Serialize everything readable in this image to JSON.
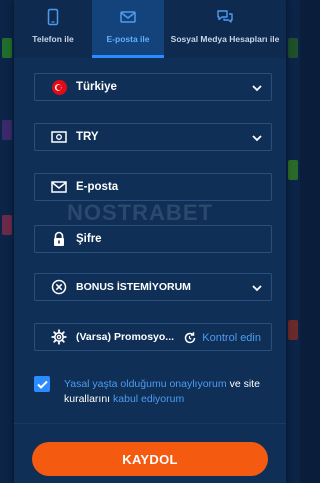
{
  "tabs": [
    {
      "label": "Telefon ile",
      "icon": "phone-icon"
    },
    {
      "label": "E-posta ile",
      "icon": "envelope-icon",
      "active": true
    },
    {
      "label": "Sosyal Medya Hesapları ile",
      "icon": "chat-bubbles-icon"
    }
  ],
  "form": {
    "country": "Türkiye",
    "currency": "TRY",
    "email_placeholder": "E-posta",
    "password_placeholder": "Şifre",
    "bonus": "BONUS İSTEMİYORUM",
    "promo_placeholder": "(Varsa) Promosyo...",
    "promo_check_label": "Kontrol edin"
  },
  "consent": {
    "part1": "Yasal yaşta olduğumu onaylıyorum",
    "part2": " ve ",
    "part3": "site kurallarını",
    "part4": " kabul ediyorum",
    "checked": true
  },
  "submit_label": "KAYDOL",
  "watermark": "NOSTRABET",
  "colors": {
    "accent": "#2b8cff",
    "button": "#f45b11",
    "background": "#0f2f57"
  }
}
